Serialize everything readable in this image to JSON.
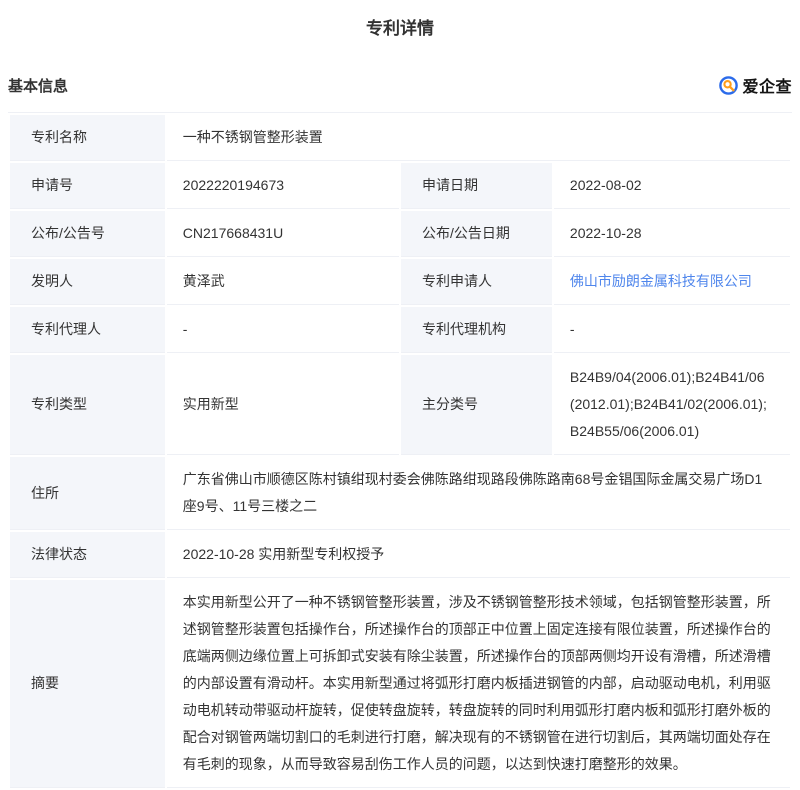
{
  "page": {
    "title": "专利详情"
  },
  "section": {
    "heading": "基本信息"
  },
  "brand": {
    "name": "爱企查"
  },
  "colors": {
    "link_blue": "#4f86ec",
    "brand_blue": "#2b6bea",
    "brand_orange": "#ff9e1c",
    "label_bg": "#f4f6fa",
    "row_line": "#eef0f5"
  },
  "table": {
    "rows": [
      {
        "type": "full",
        "label": "专利名称",
        "value": "一种不锈钢管整形装置"
      },
      {
        "type": "pair",
        "label1": "申请号",
        "value1": "2022220194673",
        "label2": "申请日期",
        "value2": "2022-08-02"
      },
      {
        "type": "pair",
        "label1": "公布/公告号",
        "value1": "CN217668431U",
        "label2": "公布/公告日期",
        "value2": "2022-10-28"
      },
      {
        "type": "pair",
        "label1": "发明人",
        "value1": "黄泽武",
        "label2": "专利申请人",
        "value2": "佛山市励朗金属科技有限公司",
        "link2": true
      },
      {
        "type": "pair",
        "label1": "专利代理人",
        "value1": "-",
        "label2": "专利代理机构",
        "value2": "-"
      },
      {
        "type": "pair",
        "label1": "专利类型",
        "value1": "实用新型",
        "label2": "主分类号",
        "value2": "B24B9/04(2006.01);B24B41/06(2012.01);B24B41/02(2006.01);B24B55/06(2006.01)"
      },
      {
        "type": "full",
        "label": "住所",
        "value": "广东省佛山市顺德区陈村镇绀现村委会佛陈路绀现路段佛陈路南68号金锠国际金属交易广场D1座9号、11号三楼之二"
      },
      {
        "type": "full",
        "label": "法律状态",
        "value": "2022-10-28 实用新型专利权授予"
      },
      {
        "type": "full",
        "label": "摘要",
        "value": "本实用新型公开了一种不锈钢管整形装置，涉及不锈钢管整形技术领域，包括钢管整形装置，所述钢管整形装置包括操作台，所述操作台的顶部正中位置上固定连接有限位装置，所述操作台的底端两侧边缘位置上可拆卸式安装有除尘装置，所述操作台的顶部两侧均开设有滑槽，所述滑槽的内部设置有滑动杆。本实用新型通过将弧形打磨内板插进钢管的内部，启动驱动电机，利用驱动电机转动带驱动杆旋转，促使转盘旋转，转盘旋转的同时利用弧形打磨内板和弧形打磨外板的配合对钢管两端切割口的毛刺进行打磨，解决现有的不锈钢管在进行切割后，其两端切面处存在有毛刺的现象，从而导致容易刮伤工作人员的问题，以达到快速打磨整形的效果。"
      }
    ]
  }
}
